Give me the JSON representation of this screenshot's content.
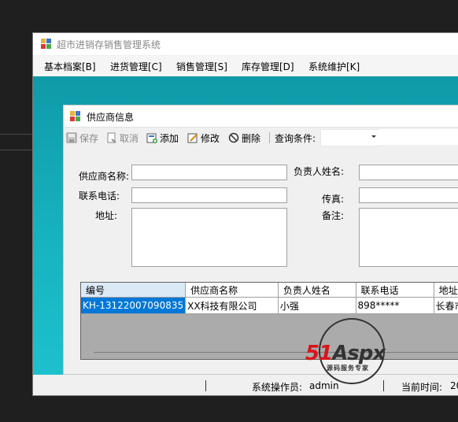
{
  "main_window": {
    "title": "超市进销存销售管理系统",
    "menu": [
      "基本档案[B]",
      "进货管理[C]",
      "销售管理[S]",
      "库存管理[D]",
      "系统维护[K]"
    ]
  },
  "child_window": {
    "title": "供应商信息",
    "toolbar": {
      "save": "保存",
      "cancel": "取消",
      "add": "添加",
      "edit": "修改",
      "delete": "删除",
      "query_label": "查询条件:"
    },
    "form": {
      "supplier_name_label": "供应商名称:",
      "contact_person_label": "负责人姓名:",
      "phone_label": "联系电话:",
      "fax_label": "传真:",
      "address_label": "地址:",
      "remarks_label": "备注:"
    },
    "grid": {
      "columns": [
        "编号",
        "供应商名称",
        "负责人姓名",
        "联系电话",
        "地址"
      ],
      "rows": [
        [
          "KH-13122007090835",
          "XX科技有限公司",
          "小强",
          "898*****",
          "长春市"
        ]
      ]
    }
  },
  "statusbar": {
    "operator_label": "系统操作员:",
    "operator": "admin",
    "time_label": "当前时间:",
    "time_value": "20"
  },
  "watermark": {
    "logo_digits": "51",
    "logo_text": "Aspx",
    "tagline": "源码服务专家"
  }
}
